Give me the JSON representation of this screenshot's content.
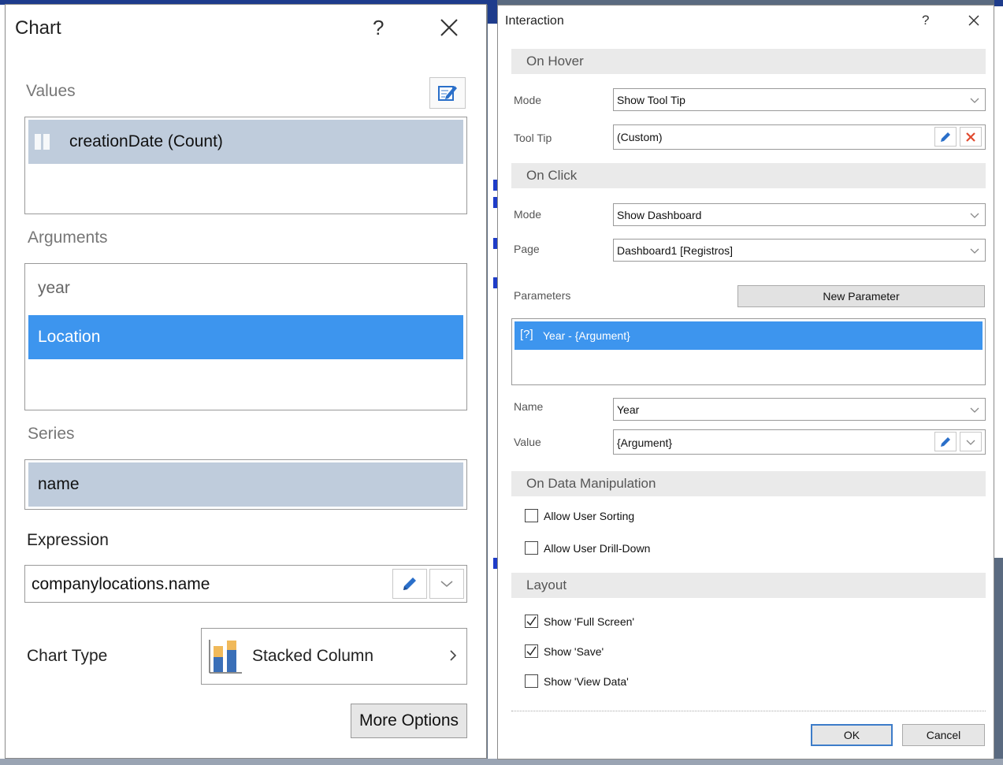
{
  "chart_dialog": {
    "title": "Chart",
    "help_glyph": "?",
    "values": {
      "label": "Values",
      "items": [
        "creationDate (Count)"
      ]
    },
    "arguments": {
      "label": "Arguments",
      "items": [
        "year",
        "Location"
      ],
      "selected": "Location"
    },
    "series": {
      "label": "Series",
      "items": [
        "name"
      ]
    },
    "expression": {
      "label": "Expression",
      "value": "companylocations.name"
    },
    "chart_type": {
      "label": "Chart Type",
      "value": "Stacked Column"
    },
    "more_options_label": "More Options"
  },
  "interaction_dialog": {
    "title": "Interaction",
    "help_glyph": "?",
    "on_hover": {
      "header": "On Hover",
      "mode_label": "Mode",
      "mode_value": "Show Tool Tip",
      "tooltip_label": "Tool Tip",
      "tooltip_value": "(Custom)"
    },
    "on_click": {
      "header": "On Click",
      "mode_label": "Mode",
      "mode_value": "Show Dashboard",
      "page_label": "Page",
      "page_value": "Dashboard1 [Registros]",
      "parameters_label": "Parameters",
      "new_parameter_label": "New Parameter",
      "parameters": [
        {
          "glyph": "[?]",
          "text": "Year - {Argument}"
        }
      ],
      "name_label": "Name",
      "name_value": "Year",
      "value_label": "Value",
      "value_value": "{Argument}"
    },
    "on_data_manipulation": {
      "header": "On Data Manipulation",
      "allow_sorting": {
        "label": "Allow User Sorting",
        "checked": false
      },
      "allow_drilldown": {
        "label": "Allow User Drill-Down",
        "checked": false
      }
    },
    "layout": {
      "header": "Layout",
      "show_full_screen": {
        "label": "Show 'Full Screen'",
        "checked": true
      },
      "show_save": {
        "label": "Show 'Save'",
        "checked": true
      },
      "show_view_data": {
        "label": "Show 'View Data'",
        "checked": false
      }
    },
    "ok_label": "OK",
    "cancel_label": "Cancel"
  },
  "colors": {
    "selected_blue": "#3d95ee",
    "selected_grey": "#bfccdc",
    "delete_red": "#e04a2f",
    "pencil_blue": "#2a6fc9"
  }
}
